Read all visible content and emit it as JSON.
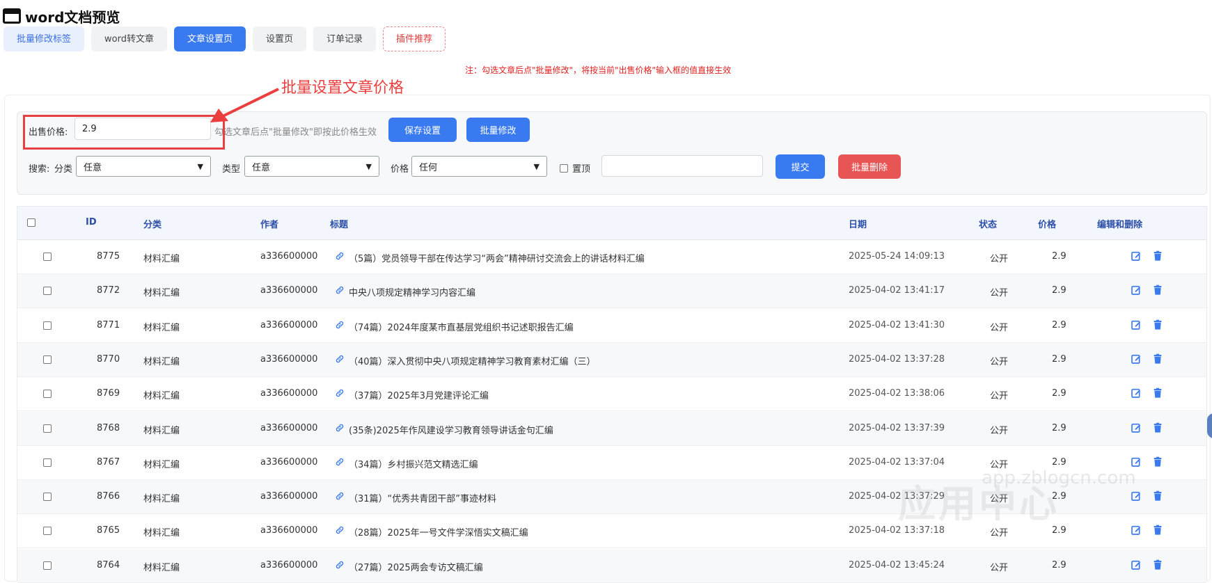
{
  "app": {
    "title": "word文档预览"
  },
  "tabs": [
    {
      "label": "批量修改标签",
      "style": "light"
    },
    {
      "label": "word转文章",
      "style": "default"
    },
    {
      "label": "文章设置页",
      "style": "active"
    },
    {
      "label": "设置页",
      "style": "default"
    },
    {
      "label": "订单记录",
      "style": "default"
    },
    {
      "label": "插件推荐",
      "style": "plugin"
    }
  ],
  "notice": "注：勾选文章后点\"批量修改\"，将按当前\"出售价格\"输入框的值直接生效",
  "annotation": {
    "text": "批量设置文章价格",
    "color": "#ea3f3f"
  },
  "price_panel": {
    "label": "出售价格:",
    "value": "2.9",
    "hint": "勾选文章后点\"批量修改\"即按此价格生效",
    "save_label": "保存设置",
    "batch_modify_label": "批量修改"
  },
  "search": {
    "label": "搜索:",
    "category_label": "分类",
    "category_value": "任意",
    "type_label": "类型",
    "type_value": "任意",
    "price_label": "价格",
    "price_value": "任何",
    "pin_label": "置顶",
    "keyword_value": "",
    "submit_label": "提交",
    "batch_delete_label": "批量删除"
  },
  "table": {
    "columns": [
      "ID",
      "分类",
      "作者",
      "标题",
      "日期",
      "状态",
      "价格",
      "编辑和删除"
    ],
    "rows": [
      {
        "id": "8775",
        "category": "材料汇编",
        "author": "a336600000",
        "title": "（5篇）党员领导干部在传达学习“两会”精神研讨交流会上的讲话材料汇编",
        "date": "2025-05-24 14:09:13",
        "status": "公开",
        "price": "2.9"
      },
      {
        "id": "8772",
        "category": "材料汇编",
        "author": "a336600000",
        "title": "中央八项规定精神学习内容汇编",
        "date": "2025-04-02 13:41:17",
        "status": "公开",
        "price": "2.9"
      },
      {
        "id": "8771",
        "category": "材料汇编",
        "author": "a336600000",
        "title": "（74篇）2024年度某市直基层党组织书记述职报告汇编",
        "date": "2025-04-02 13:41:30",
        "status": "公开",
        "price": "2.9"
      },
      {
        "id": "8770",
        "category": "材料汇编",
        "author": "a336600000",
        "title": "（40篇）深入贯彻中央八项规定精神学习教育素材汇编（三）",
        "date": "2025-04-02 13:37:28",
        "status": "公开",
        "price": "2.9"
      },
      {
        "id": "8769",
        "category": "材料汇编",
        "author": "a336600000",
        "title": "（37篇）2025年3月党建评论汇编",
        "date": "2025-04-02 13:38:06",
        "status": "公开",
        "price": "2.9"
      },
      {
        "id": "8768",
        "category": "材料汇编",
        "author": "a336600000",
        "title": "(35条)2025年作风建设学习教育领导讲话金句汇编",
        "date": "2025-04-02 13:37:39",
        "status": "公开",
        "price": "2.9"
      },
      {
        "id": "8767",
        "category": "材料汇编",
        "author": "a336600000",
        "title": "（34篇）乡村振兴范文精选汇编",
        "date": "2025-04-02 13:37:04",
        "status": "公开",
        "price": "2.9"
      },
      {
        "id": "8766",
        "category": "材料汇编",
        "author": "a336600000",
        "title": "（31篇）“优秀共青团干部”事迹材料",
        "date": "2025-04-02 13:37:29",
        "status": "公开",
        "price": "2.9"
      },
      {
        "id": "8765",
        "category": "材料汇编",
        "author": "a336600000",
        "title": "（28篇）2025年一号文件学深悟实文稿汇编",
        "date": "2025-04-02 13:37:18",
        "status": "公开",
        "price": "2.9"
      },
      {
        "id": "8764",
        "category": "材料汇编",
        "author": "a336600000",
        "title": "（27篇）2025两会专访文稿汇编",
        "date": "2025-04-02 13:45:24",
        "status": "公开",
        "price": "2.9"
      }
    ]
  },
  "watermark": {
    "text": "应用中心",
    "url": "app.zblogcn.com"
  },
  "colors": {
    "primary": "#3a7af0",
    "danger": "#e85555",
    "header_text": "#2b4fa8",
    "notice": "#e02020"
  },
  "icons": {
    "link": "link-icon",
    "edit": "edit-icon",
    "delete": "trash-icon"
  }
}
